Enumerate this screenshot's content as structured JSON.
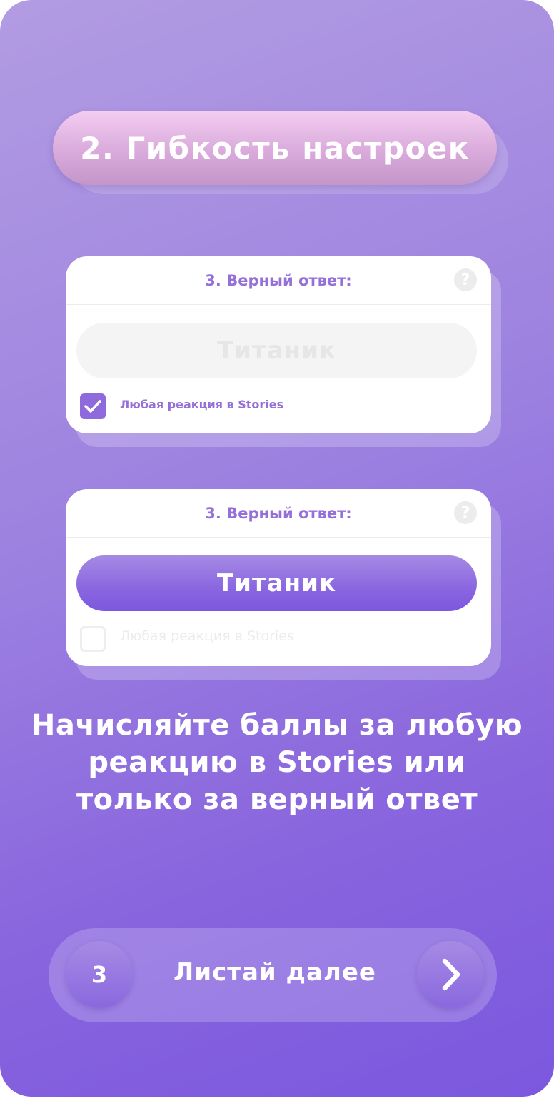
{
  "title": "2. Гибкость настроек",
  "cards": [
    {
      "header": "3. Верный ответ:",
      "help_icon": "?",
      "answer": "Титаник",
      "answer_state": "inactive",
      "checkbox_checked": true,
      "checkbox_label": "Любая реакция в Stories"
    },
    {
      "header": "3. Верный ответ:",
      "help_icon": "?",
      "answer": "Титаник",
      "answer_state": "active",
      "checkbox_checked": false,
      "checkbox_label": "Любая реакция в Stories"
    }
  ],
  "description": "Начисляйте баллы за любую реакцию в Stories или только за верный ответ",
  "nav": {
    "page_number": "3",
    "label": "Листай далее",
    "next_icon": "chevron-right-icon"
  },
  "colors": {
    "background_start": "#b29ce2",
    "background_end": "#7b58de",
    "accent": "#9470d8",
    "title_pill": "#e0b4e0"
  }
}
